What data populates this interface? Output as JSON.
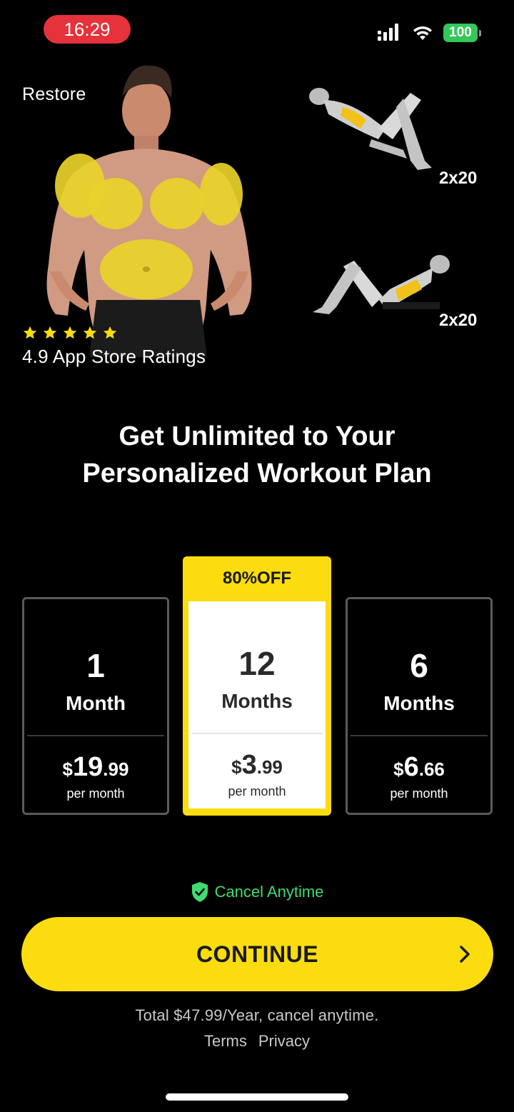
{
  "status_bar": {
    "time": "16:29",
    "battery": "100"
  },
  "header": {
    "restore_label": "Restore"
  },
  "exercises": [
    {
      "reps": "2x20"
    },
    {
      "reps": "2x20"
    }
  ],
  "rating": {
    "stars": 5,
    "text": "4.9 App Store Ratings",
    "star_color": "#fadc0f"
  },
  "headline": {
    "line1": "Get Unlimited to Your",
    "line2": "Personalized Workout Plan"
  },
  "plans": [
    {
      "number": "1",
      "unit": "Month",
      "currency": "$",
      "price_major": "19",
      "price_minor": ".99",
      "per": "per month"
    },
    {
      "badge": "80%OFF",
      "number": "12",
      "unit": "Months",
      "currency": "$",
      "price_major": "3",
      "price_minor": ".99",
      "per": "per month",
      "selected": true
    },
    {
      "number": "6",
      "unit": "Months",
      "currency": "$",
      "price_major": "6",
      "price_minor": ".66",
      "per": "per month"
    }
  ],
  "cancel_note": "Cancel Anytime",
  "cta": {
    "label": "CONTINUE"
  },
  "footer": {
    "total_text": "Total $47.99/Year, cancel anytime.",
    "terms": "Terms",
    "privacy": "Privacy"
  },
  "colors": {
    "accent": "#fadc0f",
    "green": "#3fdc72",
    "status_red": "#e5323b",
    "battery_green": "#34c759"
  }
}
